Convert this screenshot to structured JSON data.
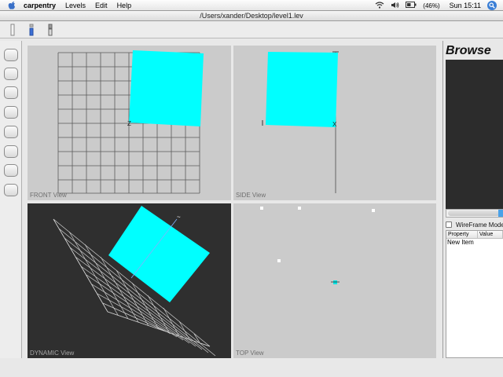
{
  "menubar": {
    "apple_icon": "apple-icon",
    "app_name": "carpentry",
    "menus": [
      "Levels",
      "Edit",
      "Help"
    ],
    "battery_text": "(46%)",
    "clock": "Sun 15:11"
  },
  "window": {
    "title": "/Users/xander/Desktop/level1.lev"
  },
  "viewports": {
    "front": {
      "label": "FRONT View"
    },
    "side": {
      "label": "SIDE View"
    },
    "dynamic": {
      "label": "DYNAMIC View"
    },
    "top": {
      "label": "TOP View"
    }
  },
  "browse": {
    "title": "Browse",
    "wireframe_label": "WireFrame Mode",
    "wireframe_checked": false,
    "columns": [
      "Property",
      "Value"
    ],
    "rows": [
      {
        "property": "New Item",
        "value": ""
      }
    ]
  },
  "colors": {
    "cube": "#00ffff",
    "grid": "#555555",
    "viewport_bg": "#cbcbcb",
    "dark_bg": "#2f2f2f"
  }
}
